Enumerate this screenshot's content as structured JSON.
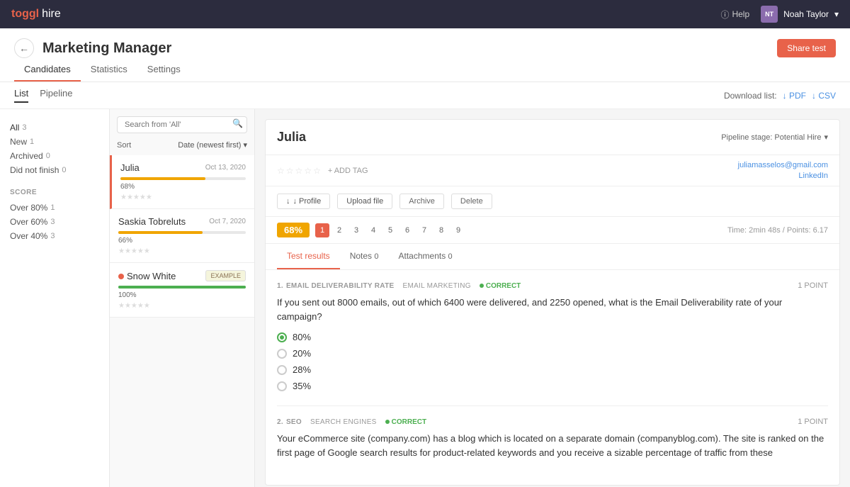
{
  "topnav": {
    "logo_toggl": "toggl",
    "logo_hire": "hire",
    "help_label": "Help",
    "user_avatar_initials": "NT",
    "user_name": "Noah Taylor"
  },
  "page": {
    "back_label": "←",
    "title": "Marketing Manager",
    "tabs": [
      "Candidates",
      "Statistics",
      "Settings"
    ],
    "active_tab": "Candidates",
    "share_test_label": "Share test"
  },
  "view_controls": {
    "list_label": "List",
    "pipeline_label": "Pipeline",
    "active_view": "List",
    "download_label": "Download list:",
    "pdf_label": "↓ PDF",
    "csv_label": "↓ CSV"
  },
  "left_sidebar": {
    "filters": [
      {
        "label": "All",
        "count": "3"
      },
      {
        "label": "New",
        "count": "1"
      },
      {
        "label": "Archived",
        "count": "0"
      },
      {
        "label": "Did not finish",
        "count": "0"
      }
    ],
    "score_heading": "SCORE",
    "score_filters": [
      {
        "label": "Over 80%",
        "count": "1"
      },
      {
        "label": "Over 60%",
        "count": "3"
      },
      {
        "label": "Over 40%",
        "count": "3"
      }
    ]
  },
  "search": {
    "placeholder": "Search from 'All'"
  },
  "sort": {
    "label": "Sort",
    "value": "Date (newest first)",
    "chevron": "▾"
  },
  "candidates": [
    {
      "name": "Julia",
      "date": "Oct 13, 2020",
      "score": "68%",
      "score_class": "score-68",
      "active": true,
      "example": false,
      "dot": false
    },
    {
      "name": "Saskia Tobreluts",
      "date": "Oct 7, 2020",
      "score": "66%",
      "score_class": "score-66",
      "active": false,
      "example": false,
      "dot": false
    },
    {
      "name": "Snow White",
      "date": "",
      "score": "100%",
      "score_class": "score-100",
      "active": false,
      "example": true,
      "dot": true
    }
  ],
  "detail": {
    "name": "Julia",
    "pipeline_stage": "Pipeline stage: Potential Hire",
    "email": "juliamasselos@gmail.com",
    "linkedin": "LinkedIn",
    "add_tag_label": "+ ADD TAG",
    "profile_btn": "↓ Profile",
    "upload_btn": "Upload file",
    "archive_btn": "Archive",
    "delete_btn": "Delete",
    "score": "68%",
    "pages": [
      "1",
      "2",
      "3",
      "4",
      "5",
      "6",
      "7",
      "8",
      "9"
    ],
    "active_page": "1",
    "time_points": "Time: 2min 48s / Points: 6.17",
    "tabs": [
      {
        "label": "Test results",
        "count": ""
      },
      {
        "label": "Notes",
        "count": "0"
      },
      {
        "label": "Attachments",
        "count": "0"
      }
    ],
    "active_detail_tab": "Test results"
  },
  "questions": [
    {
      "num": "1.",
      "title": "EMAIL DELIVERABILITY RATE",
      "category": "EMAIL MARKETING",
      "correct": true,
      "correct_label": "CORRECT",
      "points": "1 POINT",
      "text": "If you sent out 8000 emails, out of which 6400 were delivered, and 2250 opened, what is the Email Deliverability rate of your campaign?",
      "options": [
        {
          "label": "80%",
          "selected": true
        },
        {
          "label": "20%",
          "selected": false
        },
        {
          "label": "28%",
          "selected": false
        },
        {
          "label": "35%",
          "selected": false
        }
      ]
    },
    {
      "num": "2.",
      "title": "SEO",
      "category": "SEARCH ENGINES",
      "correct": true,
      "correct_label": "CORRECT",
      "points": "1 POINT",
      "text": "Your eCommerce site (company.com) has a blog which is located on a separate domain (companyblog.com). The site is ranked on the first page of Google search results for product-related keywords and you receive a sizable percentage of traffic from these"
    }
  ]
}
